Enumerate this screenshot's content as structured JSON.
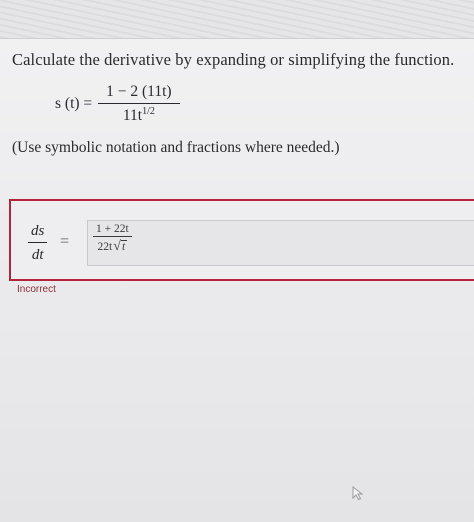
{
  "question": {
    "prompt": "Calculate the derivative by expanding or simplifying the function.",
    "function_name": "s (t) =",
    "numerator": "1 − 2 (11t)",
    "denominator_base": "11t",
    "denominator_exponent": "1/2",
    "note": "(Use symbolic notation and fractions where needed.)"
  },
  "answer": {
    "lhs_numerator": "ds",
    "lhs_denominator": "dt",
    "equals": "=",
    "input_numerator": "1 + 22t",
    "input_denominator_prefix": "22t",
    "input_sqrt_argument": "t",
    "status": "Incorrect",
    "status_color": "#b2243a"
  },
  "icons": {
    "cursor": "mouse-cursor-icon"
  }
}
